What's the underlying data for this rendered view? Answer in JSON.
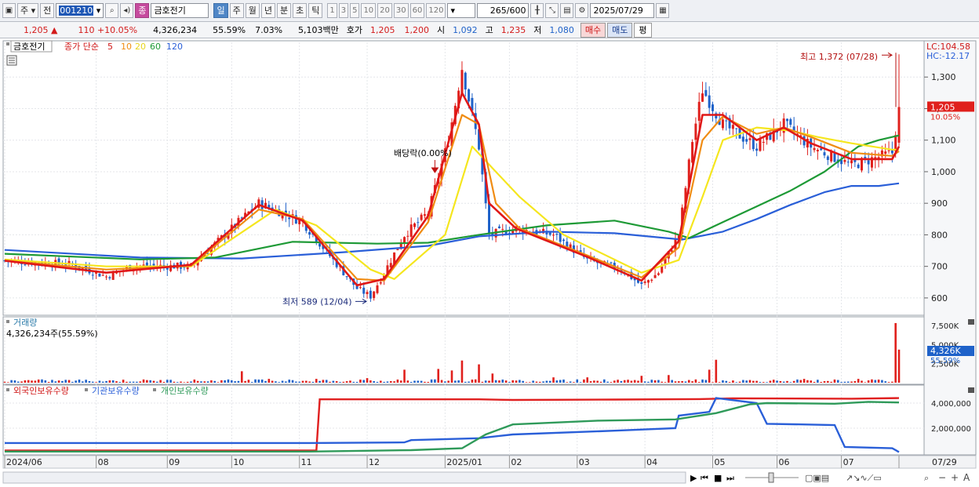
{
  "toolbar": {
    "mode_left": "주",
    "prev_label": "전",
    "code": "001210",
    "badge": "종",
    "stock_name": "금호전기",
    "periods": [
      "일",
      "주",
      "월",
      "년",
      "분",
      "초",
      "틱"
    ],
    "active_period": "일",
    "minutes": [
      "1",
      "3",
      "5",
      "10",
      "20",
      "30",
      "60",
      "120"
    ],
    "count": "265",
    "count_total": "/600",
    "date": "2025/07/29"
  },
  "quote": {
    "price": "1,205",
    "change": "110",
    "change_rate": "+10.05%",
    "volume": "4,326,234",
    "volume_ratio": "55.59%",
    "turnover": "7.03%",
    "amount": "5,103백만",
    "hoga_label": "호가",
    "hoga_ask": "1,205",
    "hoga_bid": "1,200",
    "open_label": "시",
    "open": "1,092",
    "high_label": "고",
    "high": "1,235",
    "low_label": "저",
    "low": "1,080",
    "buy_label": "매수",
    "sell_label": "매도",
    "eval_label": "평"
  },
  "price_panel": {
    "title": "금호전기",
    "ma_label": "종가 단순",
    "ma_periods": [
      "5",
      "10",
      "20",
      "60",
      "120"
    ],
    "lc": "LC:104.58",
    "hc": "HC:-12.17",
    "current_price": "1,205",
    "current_rate": "10.05%",
    "max_label": "최고 1,372 (07/28)",
    "min_label": "최저 589 (12/04)",
    "dividend_label": "배당락(0.00%)"
  },
  "volume_panel": {
    "title": "거래량",
    "value_text": "4,326,234주(55.59%)",
    "current_label": "4,326K",
    "current_ratio": "55.59%"
  },
  "holding_panel": {
    "legend": [
      "외국인보유수량",
      "기관보유수량",
      "개인보유수량"
    ]
  },
  "colors": {
    "up": "#e0201c",
    "down": "#1f62c9",
    "ma5": "#e01818",
    "ma10": "#f08c12",
    "ma20": "#f5e61e",
    "ma60": "#1e9a36",
    "ma120": "#2a5fd8",
    "foreign": "#e02020",
    "institution": "#2a5fd8",
    "individual": "#2f9a5a"
  },
  "chart_data": [
    {
      "type": "candlestick",
      "title": "금호전기",
      "ylim": [
        560,
        1400
      ],
      "y_ticks": [
        600,
        700,
        800,
        900,
        1000,
        1100,
        1200,
        1300
      ],
      "y_tick_labels": [
        "600",
        "700",
        "800",
        "900",
        "1,000",
        "1,100",
        "1,200",
        "1,300"
      ],
      "x_labels": [
        "2024/06",
        "08",
        "09",
        "10",
        "11",
        "12",
        "2025/01",
        "02",
        "03",
        "04",
        "05",
        "06",
        "07",
        "07/29"
      ],
      "x_label_index": [
        0,
        27,
        48,
        67,
        87,
        107,
        130,
        149,
        169,
        189,
        209,
        228,
        247,
        264
      ],
      "close_anchors": [
        [
          0,
          718
        ],
        [
          20,
          706
        ],
        [
          30,
          668
        ],
        [
          38,
          702
        ],
        [
          55,
          700
        ],
        [
          62,
          770
        ],
        [
          75,
          900
        ],
        [
          82,
          870
        ],
        [
          88,
          840
        ],
        [
          97,
          720
        ],
        [
          104,
          630
        ],
        [
          108,
          605
        ],
        [
          112,
          680
        ],
        [
          118,
          800
        ],
        [
          125,
          870
        ],
        [
          131,
          1100
        ],
        [
          135,
          1330
        ],
        [
          140,
          1080
        ],
        [
          143,
          800
        ],
        [
          151,
          820
        ],
        [
          162,
          800
        ],
        [
          172,
          720
        ],
        [
          182,
          690
        ],
        [
          188,
          640
        ],
        [
          193,
          680
        ],
        [
          199,
          800
        ],
        [
          203,
          1100
        ],
        [
          206,
          1260
        ],
        [
          212,
          1150
        ],
        [
          222,
          1080
        ],
        [
          230,
          1150
        ],
        [
          238,
          1080
        ],
        [
          250,
          1020
        ],
        [
          262,
          1060
        ],
        [
          264,
          1205
        ]
      ],
      "ma": {
        "ma5": [
          [
            0,
            718
          ],
          [
            30,
            680
          ],
          [
            55,
            705
          ],
          [
            75,
            895
          ],
          [
            88,
            845
          ],
          [
            104,
            640
          ],
          [
            112,
            660
          ],
          [
            125,
            860
          ],
          [
            135,
            1250
          ],
          [
            140,
            1150
          ],
          [
            143,
            900
          ],
          [
            151,
            820
          ],
          [
            172,
            730
          ],
          [
            188,
            655
          ],
          [
            199,
            780
          ],
          [
            206,
            1180
          ],
          [
            212,
            1180
          ],
          [
            222,
            1100
          ],
          [
            230,
            1140
          ],
          [
            238,
            1090
          ],
          [
            250,
            1040
          ],
          [
            262,
            1040
          ],
          [
            264,
            1080
          ]
        ],
        "ma10": [
          [
            0,
            718
          ],
          [
            30,
            690
          ],
          [
            55,
            702
          ],
          [
            75,
            880
          ],
          [
            88,
            850
          ],
          [
            104,
            660
          ],
          [
            112,
            655
          ],
          [
            125,
            840
          ],
          [
            135,
            1180
          ],
          [
            140,
            1150
          ],
          [
            145,
            900
          ],
          [
            152,
            820
          ],
          [
            172,
            735
          ],
          [
            188,
            665
          ],
          [
            199,
            760
          ],
          [
            206,
            1100
          ],
          [
            212,
            1175
          ],
          [
            222,
            1120
          ],
          [
            230,
            1140
          ],
          [
            238,
            1110
          ],
          [
            250,
            1060
          ],
          [
            262,
            1050
          ],
          [
            264,
            1065
          ]
        ],
        "ma20": [
          [
            0,
            722
          ],
          [
            30,
            700
          ],
          [
            55,
            700
          ],
          [
            80,
            880
          ],
          [
            92,
            830
          ],
          [
            108,
            690
          ],
          [
            115,
            660
          ],
          [
            130,
            800
          ],
          [
            138,
            1080
          ],
          [
            145,
            1000
          ],
          [
            152,
            920
          ],
          [
            165,
            800
          ],
          [
            188,
            680
          ],
          [
            199,
            720
          ],
          [
            206,
            920
          ],
          [
            212,
            1100
          ],
          [
            222,
            1140
          ],
          [
            232,
            1130
          ],
          [
            240,
            1110
          ],
          [
            250,
            1090
          ],
          [
            262,
            1070
          ],
          [
            264,
            1070
          ]
        ],
        "ma60": [
          [
            0,
            740
          ],
          [
            40,
            722
          ],
          [
            62,
            728
          ],
          [
            85,
            778
          ],
          [
            110,
            772
          ],
          [
            125,
            775
          ],
          [
            140,
            800
          ],
          [
            160,
            830
          ],
          [
            180,
            845
          ],
          [
            196,
            810
          ],
          [
            202,
            790
          ],
          [
            212,
            840
          ],
          [
            222,
            890
          ],
          [
            232,
            940
          ],
          [
            242,
            1000
          ],
          [
            252,
            1080
          ],
          [
            258,
            1100
          ],
          [
            264,
            1115
          ]
        ],
        "ma120": [
          [
            0,
            752
          ],
          [
            40,
            728
          ],
          [
            70,
            725
          ],
          [
            100,
            745
          ],
          [
            125,
            765
          ],
          [
            140,
            795
          ],
          [
            160,
            810
          ],
          [
            180,
            805
          ],
          [
            200,
            785
          ],
          [
            212,
            810
          ],
          [
            222,
            850
          ],
          [
            232,
            895
          ],
          [
            242,
            935
          ],
          [
            250,
            955
          ],
          [
            258,
            955
          ],
          [
            264,
            963
          ]
        ]
      }
    },
    {
      "type": "bar",
      "title": "거래량",
      "ylim": [
        0,
        8000000
      ],
      "y_tick_labels": [
        "7,500K",
        "5,000K",
        "2,500K"
      ],
      "current_value": 4326234,
      "spikes": [
        [
          70,
          1500000
        ],
        [
          78,
          500000
        ],
        [
          92,
          500000
        ],
        [
          107,
          600000
        ],
        [
          118,
          1700000
        ],
        [
          128,
          1800000
        ],
        [
          132,
          1600000
        ],
        [
          135,
          2900000
        ],
        [
          140,
          2400000
        ],
        [
          144,
          1200000
        ],
        [
          162,
          700000
        ],
        [
          172,
          700000
        ],
        [
          188,
          900000
        ],
        [
          196,
          1000000
        ],
        [
          208,
          1700000
        ],
        [
          210,
          3000000
        ],
        [
          236,
          500000
        ],
        [
          252,
          500000
        ],
        [
          263,
          7800000
        ],
        [
          264,
          4326234
        ]
      ]
    },
    {
      "type": "line",
      "title": "보유수량",
      "ylim": [
        0,
        5000000
      ],
      "y_ticks": [
        2000000,
        4000000
      ],
      "y_tick_labels": [
        "2,000,000",
        "4,000,000"
      ],
      "series": [
        {
          "name": "외국인보유수량",
          "values": [
            [
              0,
              220000
            ],
            [
              92,
              220000
            ],
            [
              93,
              4300000
            ],
            [
              140,
              4300000
            ],
            [
              150,
              4250000
            ],
            [
              180,
              4280000
            ],
            [
              205,
              4320000
            ],
            [
              215,
              4380000
            ],
            [
              250,
              4350000
            ],
            [
              264,
              4400000
            ]
          ]
        },
        {
          "name": "기관보유수량",
          "values": [
            [
              0,
              820000
            ],
            [
              90,
              820000
            ],
            [
              118,
              870000
            ],
            [
              120,
              1050000
            ],
            [
              140,
              1200000
            ],
            [
              150,
              1500000
            ],
            [
              180,
              1800000
            ],
            [
              198,
              2000000
            ],
            [
              199,
              3000000
            ],
            [
              208,
              3300000
            ],
            [
              210,
              4400000
            ],
            [
              222,
              4000000
            ],
            [
              225,
              2350000
            ],
            [
              245,
              2250000
            ],
            [
              248,
              500000
            ],
            [
              262,
              400000
            ],
            [
              264,
              100000
            ]
          ]
        },
        {
          "name": "개인보유수량",
          "values": [
            [
              0,
              140000
            ],
            [
              90,
              140000
            ],
            [
              120,
              250000
            ],
            [
              135,
              400000
            ],
            [
              142,
              1500000
            ],
            [
              150,
              2300000
            ],
            [
              175,
              2600000
            ],
            [
              198,
              2700000
            ],
            [
              210,
              3200000
            ],
            [
              220,
              3900000
            ],
            [
              225,
              4000000
            ],
            [
              245,
              3950000
            ],
            [
              255,
              4100000
            ],
            [
              264,
              4050000
            ]
          ]
        }
      ]
    }
  ]
}
